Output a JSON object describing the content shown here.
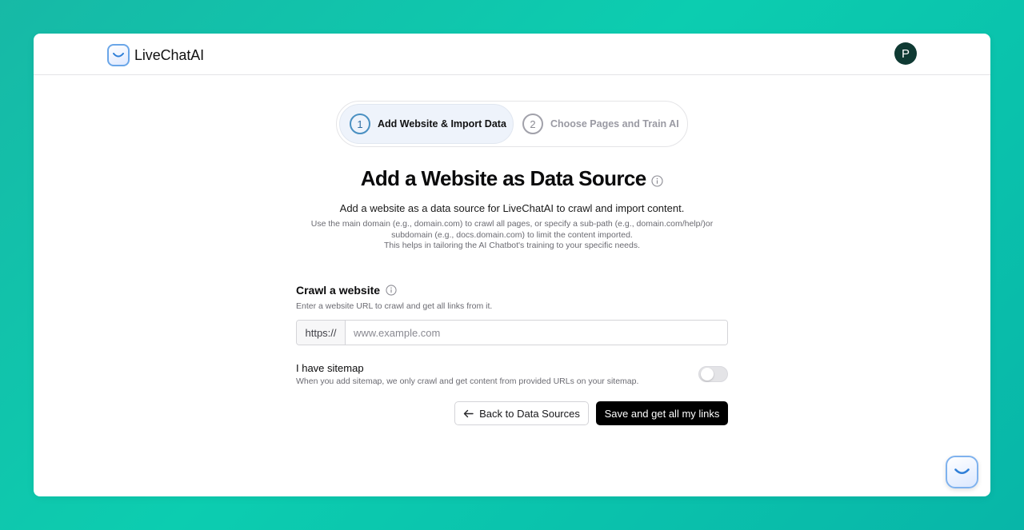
{
  "app": {
    "name": "LiveChatAI"
  },
  "user": {
    "avatar_initial": "P"
  },
  "stepper": {
    "steps": [
      {
        "number": "1",
        "label": "Add Website & Import Data",
        "state": "active"
      },
      {
        "number": "2",
        "label": "Choose Pages and Train AI",
        "state": "inactive"
      }
    ]
  },
  "page": {
    "title": "Add a Website as Data Source",
    "subtitle": "Add a website as a data source for LiveChatAI to crawl and import content.",
    "helper_line1": "Use the main domain (e.g., domain.com) to crawl all pages, or specify a sub-path (e.g., domain.com/help/)or",
    "helper_line2": "subdomain (e.g., docs.domain.com) to limit the content imported.",
    "helper_line3": "This helps in tailoring the AI Chatbot's training to your specific needs."
  },
  "crawl": {
    "label": "Crawl a website",
    "description": "Enter a website URL to crawl and get all links from it.",
    "prefix": "https://",
    "value": "",
    "placeholder": "www.example.com"
  },
  "sitemap": {
    "label": "I have sitemap",
    "description": "When you add sitemap, we only crawl and get content from provided URLs on your sitemap.",
    "enabled": false
  },
  "actions": {
    "back_label": "Back to Data Sources",
    "save_label": "Save and get all my links"
  },
  "colors": {
    "background_gradient": [
      "#17b9a6",
      "#0ccdb0"
    ],
    "primary_button": "#000000",
    "avatar": "#0f3a33",
    "step_active_ring": "#4a90c2"
  },
  "icons": {
    "logo": "livechatai-logo-icon",
    "info": "info-icon",
    "back": "arrow-left-icon",
    "chat_widget": "chat-widget-icon"
  }
}
